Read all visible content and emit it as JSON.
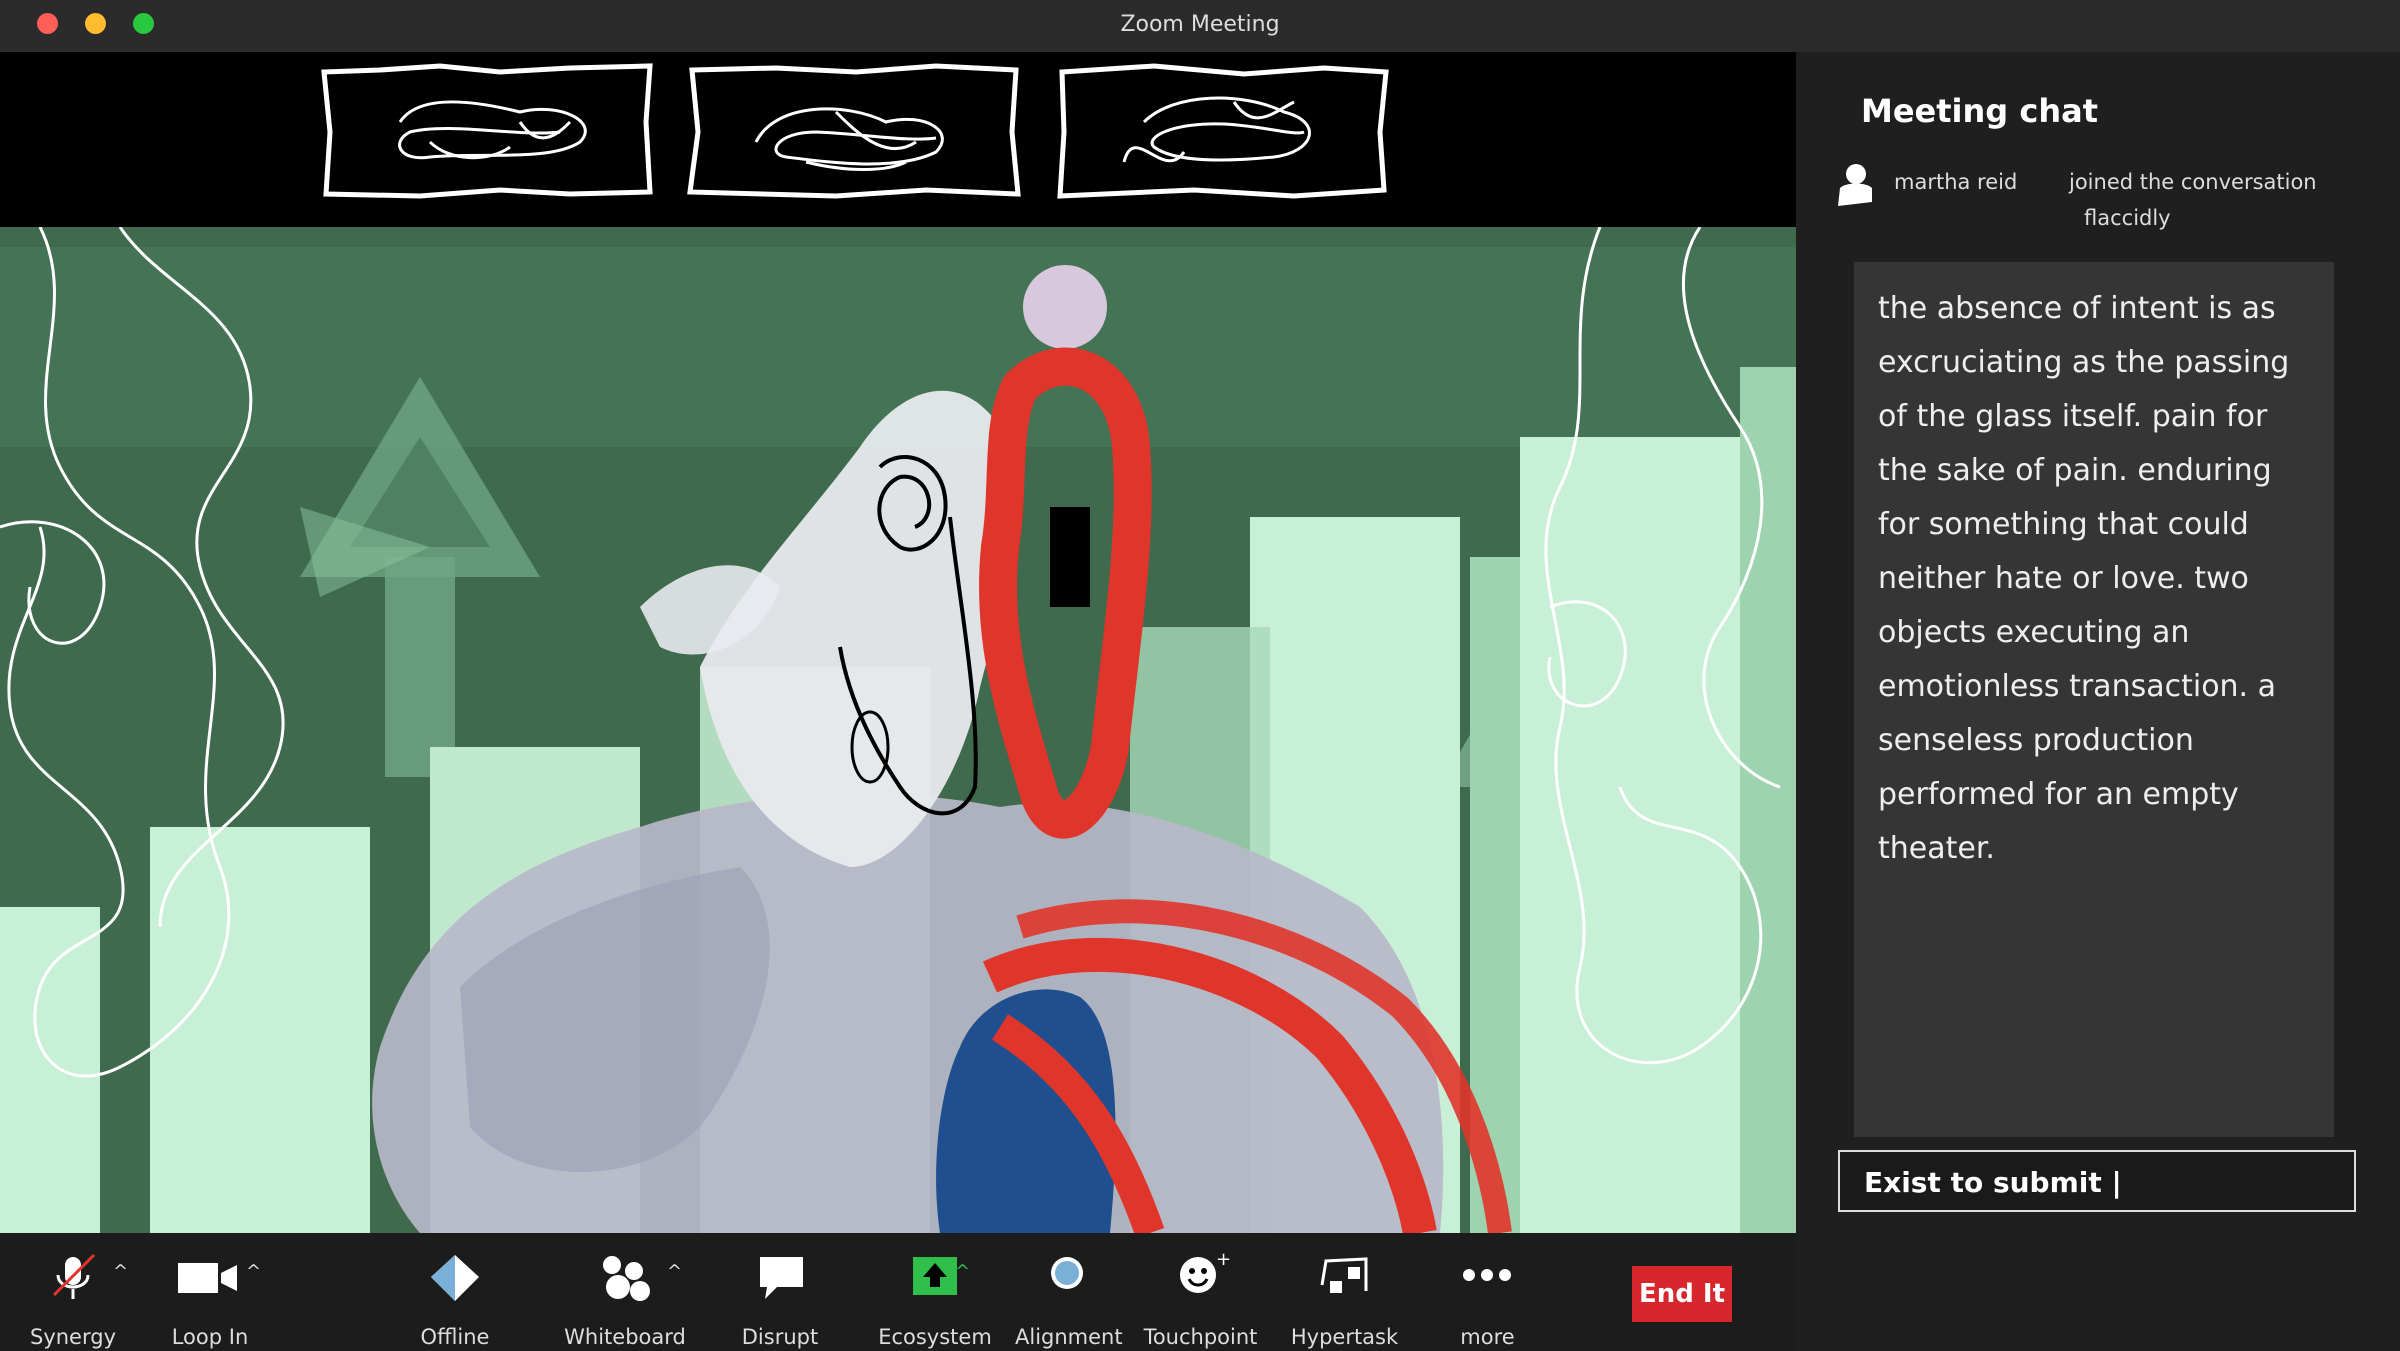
{
  "window": {
    "title": "Zoom Meeting"
  },
  "chat": {
    "title": "Meeting chat",
    "system_message": {
      "name": "martha reid",
      "action": "joined the conversation",
      "manner": "flaccidly"
    },
    "message": "the absence of intent is as excruciating as the passing of the glass itself. pain for the sake of pain. enduring for something that could neither hate or love. two objects executing an emotionless transaction. a senseless production performed for an empty theater.",
    "input": {
      "value": "Exist to submit |"
    }
  },
  "toolbar": {
    "synergy": "Synergy",
    "loop_in": "Loop In",
    "offline": "Offline",
    "whiteboard": "Whiteboard",
    "disrupt": "Disrupt",
    "ecosystem": "Ecosystem",
    "alignment": "Alignment",
    "touchpoint": "Touchpoint",
    "hypertask": "Hypertask",
    "more": "more",
    "end": "End It"
  },
  "colors": {
    "end_button": "#d8262d",
    "scene_bg": "#3f6a4e",
    "pale_green": "#c8f0d6",
    "red_stroke": "#e0352b",
    "ecosystem_icon": "#2fbf4a"
  }
}
